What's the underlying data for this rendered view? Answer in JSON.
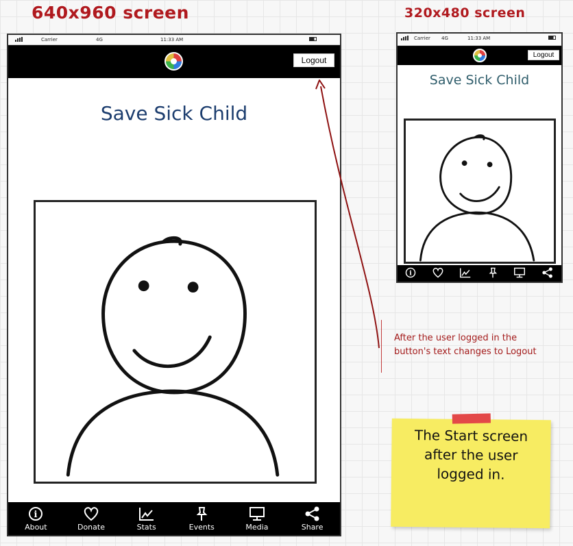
{
  "headings": {
    "large": "640x960 screen",
    "small": "320x480 screen"
  },
  "phone_large": {
    "status": {
      "carrier": "Carrier",
      "network": "4G",
      "time": "11:33 AM"
    },
    "logout_label": "Logout",
    "title": "Save Sick Child",
    "tabs": [
      {
        "label": "About",
        "icon": "info-icon"
      },
      {
        "label": "Donate",
        "icon": "heart-icon"
      },
      {
        "label": "Stats",
        "icon": "chart-icon"
      },
      {
        "label": "Events",
        "icon": "pushpin-icon"
      },
      {
        "label": "Media",
        "icon": "monitor-icon"
      },
      {
        "label": "Share",
        "icon": "share-icon"
      }
    ]
  },
  "phone_small": {
    "status": {
      "carrier": "Carrier",
      "network": "4G",
      "time": "11:33 AM"
    },
    "logout_label": "Logout",
    "title": "Save Sick Child",
    "tab_icons": [
      "info-icon",
      "heart-icon",
      "chart-icon",
      "pushpin-icon",
      "monitor-icon",
      "share-icon"
    ]
  },
  "annotation": {
    "line1": "After the user logged in the",
    "line2": "button's text changes to Logout"
  },
  "sticky_note": {
    "line1": "The Start screen",
    "line2": "after the user",
    "line3": "logged in."
  },
  "colors": {
    "heading": "#b0191e",
    "annotation": "#a31a1a",
    "title": "#1c3d6e",
    "sticky": "#f7ec62",
    "tape": "#e34848"
  }
}
